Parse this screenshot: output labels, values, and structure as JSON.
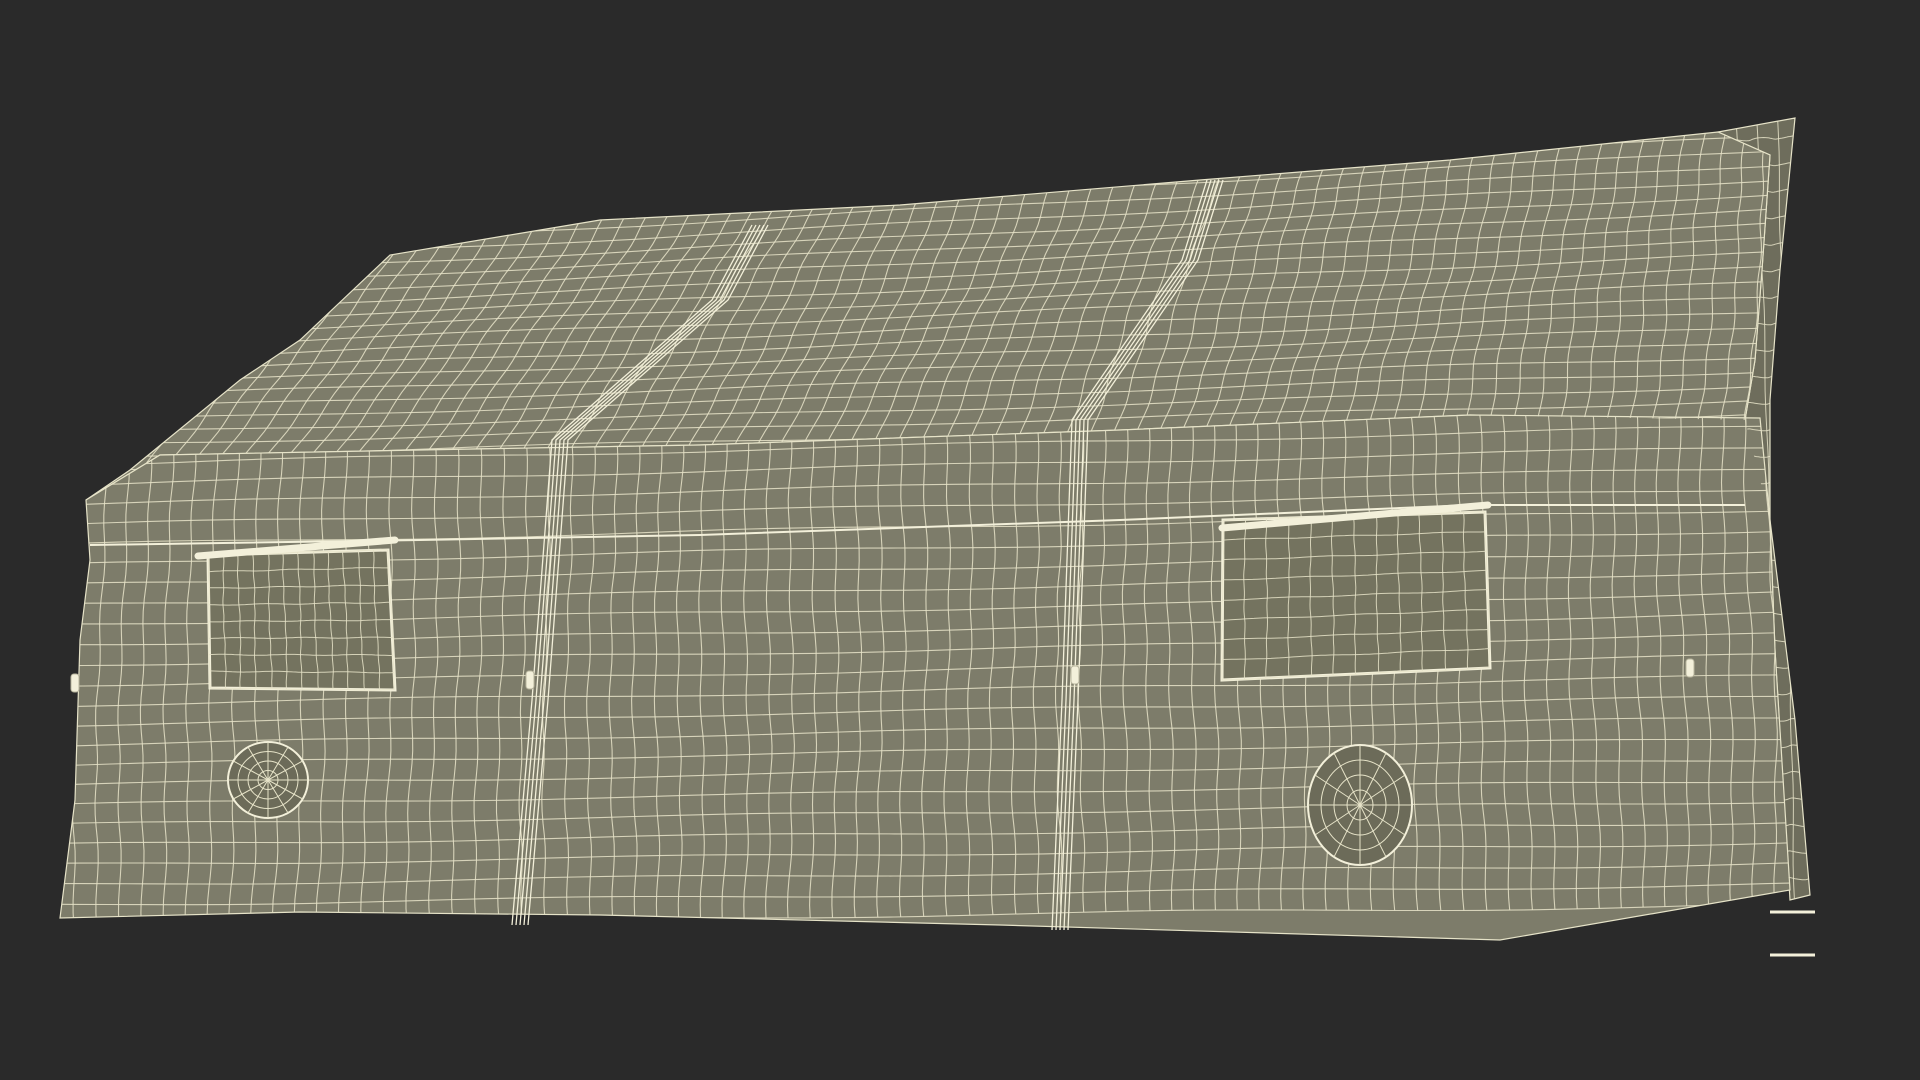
{
  "scene": {
    "subject": "tent-wireframe-render",
    "colors": {
      "background": "#2a2a2a",
      "fabric": "#7d7c6a",
      "fabric_shade": "#6e6d5c",
      "wire": "#e6e3c8",
      "seam": "#f3f0da"
    }
  }
}
